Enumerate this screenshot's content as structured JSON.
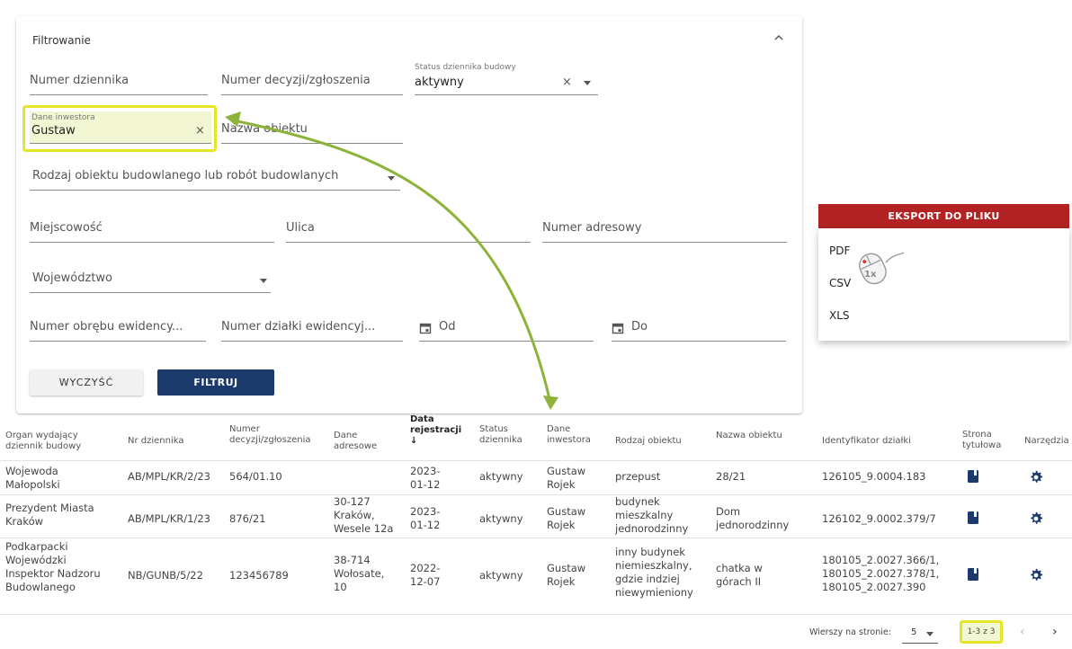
{
  "filter": {
    "title": "Filtrowanie",
    "journal_number_placeholder": "Numer dziennika",
    "decision_number_placeholder": "Numer decyzji/zgłoszenia",
    "status_label": "Status dziennika budowy",
    "status_value": "aktywny",
    "investor_label": "Dane inwestora",
    "investor_value": "Gustaw",
    "object_name_placeholder": "Nazwa obiektu",
    "object_type_placeholder": "Rodzaj obiektu budowlanego lub robót budowlanych",
    "city_placeholder": "Miejscowość",
    "street_placeholder": "Ulica",
    "address_number_placeholder": "Numer adresowy",
    "voivodeship_placeholder": "Województwo",
    "precinct_placeholder": "Numer obrębu ewidency...",
    "parcel_placeholder": "Numer działki ewidencyj...",
    "date_from_placeholder": "Od",
    "date_to_placeholder": "Do",
    "clear_button": "WYCZYŚĆ",
    "filter_button": "FILTRUJ",
    "clear_icon": "×"
  },
  "export": {
    "button_label": "EKSPORT DO PLIKU",
    "options": [
      "PDF",
      "CSV",
      "XLS"
    ],
    "click_badge": "1x"
  },
  "table": {
    "headers": {
      "organ": "Organ wydający dziennik budowy",
      "journal_no": "Nr dziennika",
      "decision_no": "Numer decyzji/zgłoszenia",
      "address": "Dane adresowe",
      "reg_date": "Data rejestracji",
      "sort_arrow": "↓",
      "status": "Status dziennika",
      "investor": "Dane inwestora",
      "object_type": "Rodzaj obiektu",
      "object_name": "Nazwa obiektu",
      "parcel_id": "Identyfikator działki",
      "title_page": "Strona tytułowa",
      "tools": "Narzędzia"
    },
    "rows": [
      {
        "organ": "Wojewoda Małopolski",
        "journal_no": "AB/MPL/KR/2/23",
        "decision_no": "564/01.10",
        "address": "",
        "reg_date": "2023-01-12",
        "status": "aktywny",
        "investor": "Gustaw Rojek",
        "object_type": "przepust",
        "object_name": "28/21",
        "parcel_id": "126105_9.0004.183"
      },
      {
        "organ": "Prezydent Miasta Kraków",
        "journal_no": "AB/MPL/KR/1/23",
        "decision_no": "876/21",
        "address": "30-127 Kraków, Wesele 12a",
        "reg_date": "2023-01-12",
        "status": "aktywny",
        "investor": "Gustaw Rojek",
        "object_type": "budynek mieszkalny jednorodzinny",
        "object_name": "Dom jednorodzinny",
        "parcel_id": "126102_9.0002.379/7"
      },
      {
        "organ": "Podkarpacki Wojewódzki Inspektor Nadzoru Budowlanego",
        "journal_no": "NB/GUNB/5/22",
        "decision_no": "123456789",
        "address": "38-714 Wołosate, 10",
        "reg_date": "2022-12-07",
        "status": "aktywny",
        "investor": "Gustaw Rojek",
        "object_type": "inny budynek niemieszkalny, gdzie indziej niewymieniony",
        "object_name": "chatka w górach II",
        "parcel_id": "180105_2.0027.366/1, 180105_2.0027.378/1, 180105_2.0027.390"
      }
    ]
  },
  "pagination": {
    "rows_per_page_label": "Wierszy na stronie:",
    "rows_per_page_value": "5",
    "range": "1-3 z 3",
    "prev": "‹",
    "next": "›"
  },
  "colors": {
    "primary": "#1b3a6b",
    "export_red": "#b22222",
    "highlight": "#e6e628",
    "annotation_arrow": "#8db33a"
  }
}
